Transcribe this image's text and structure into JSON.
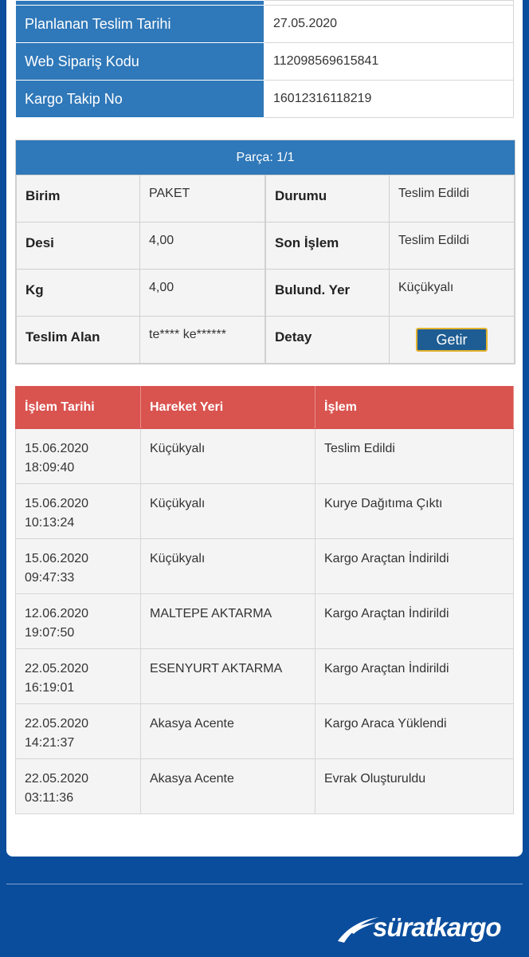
{
  "summary": {
    "rows": [
      {
        "label": "Planlanan Teslim Tarihi",
        "value": "27.05.2020"
      },
      {
        "label": "Web Sipariş Kodu",
        "value": "112098569615841"
      },
      {
        "label": "Kargo Takip No",
        "value": "16012316118219"
      }
    ]
  },
  "parca": {
    "title": "Parça: 1/1",
    "left": [
      {
        "label": "Birim",
        "value": "PAKET"
      },
      {
        "label": "Desi",
        "value": "4,00"
      },
      {
        "label": "Kg",
        "value": "4,00"
      },
      {
        "label": "Teslim Alan",
        "value": "te**** ke******"
      }
    ],
    "right": [
      {
        "label": "Durumu",
        "value": "Teslim Edildi"
      },
      {
        "label": "Son İşlem",
        "value": "Teslim Edildi"
      },
      {
        "label": "Bulund. Yer",
        "value": "Küçükyalı"
      },
      {
        "label": "Detay",
        "button": "Getir"
      }
    ]
  },
  "moves": {
    "headers": [
      "İşlem Tarihi",
      "Hareket Yeri",
      "İşlem"
    ],
    "rows": [
      {
        "date": "15.06.2020",
        "time": "18:09:40",
        "place": "Küçükyalı",
        "action": "Teslim Edildi"
      },
      {
        "date": "15.06.2020",
        "time": "10:13:24",
        "place": "Küçükyalı",
        "action": "Kurye Dağıtıma Çıktı"
      },
      {
        "date": "15.06.2020",
        "time": "09:47:33",
        "place": "Küçükyalı",
        "action": "Kargo Araçtan İndirildi"
      },
      {
        "date": "12.06.2020",
        "time": "19:07:50",
        "place": "MALTEPE AKTARMA",
        "action": "Kargo Araçtan İndirildi"
      },
      {
        "date": "22.05.2020",
        "time": "16:19:01",
        "place": "ESENYURT AKTARMA",
        "action": "Kargo Araçtan İndirildi"
      },
      {
        "date": "22.05.2020",
        "time": "14:21:37",
        "place": "Akasya Acente",
        "action": "Kargo Araca Yüklendi"
      },
      {
        "date": "22.05.2020",
        "time": "03:11:36",
        "place": "Akasya Acente",
        "action": "Evrak Oluşturuldu"
      }
    ]
  },
  "footer": {
    "logo_text": "süratkargo",
    "logo_icon": "swoosh-icon"
  },
  "colors": {
    "page_bg": "#0a4d9c",
    "header_blue": "#2f78b9",
    "header_red": "#d9534f",
    "button_border": "#e2b22d"
  }
}
